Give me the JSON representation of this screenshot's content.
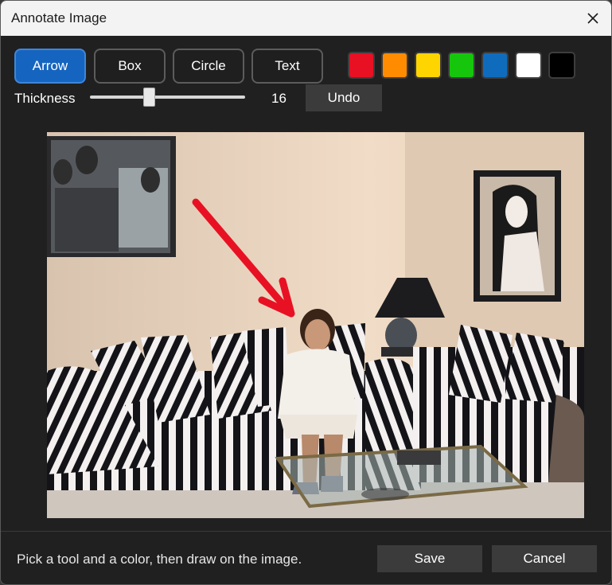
{
  "window": {
    "title": "Annotate Image"
  },
  "tools": [
    {
      "label": "Arrow",
      "active": true
    },
    {
      "label": "Box",
      "active": false
    },
    {
      "label": "Circle",
      "active": false
    },
    {
      "label": "Text",
      "active": false
    }
  ],
  "colors": [
    {
      "name": "red",
      "hex": "#e81123"
    },
    {
      "name": "orange",
      "hex": "#ff8c00"
    },
    {
      "name": "yellow",
      "hex": "#ffd500"
    },
    {
      "name": "green",
      "hex": "#16c60c"
    },
    {
      "name": "blue",
      "hex": "#0f6cbd"
    },
    {
      "name": "white",
      "hex": "#ffffff"
    },
    {
      "name": "black",
      "hex": "#000000"
    }
  ],
  "thickness": {
    "label": "Thickness",
    "value": "16",
    "fraction": 0.38
  },
  "undo_label": "Undo",
  "canvas": {
    "annotation_tool": "arrow",
    "annotation_color": "#e81123"
  },
  "footer": {
    "hint": "Pick a tool and a color, then draw on the image.",
    "save_label": "Save",
    "cancel_label": "Cancel"
  }
}
